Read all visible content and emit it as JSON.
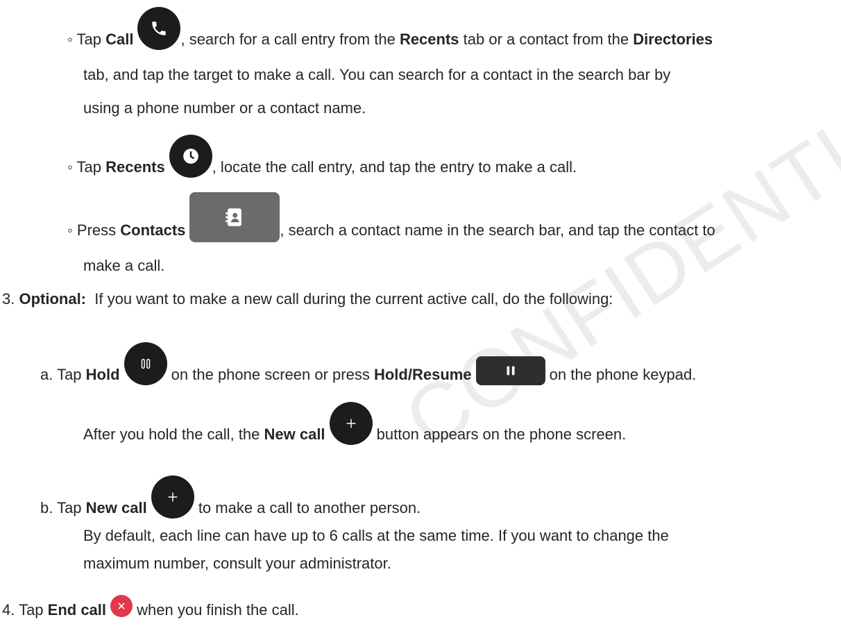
{
  "watermark": "CONFIDENTIAL DRAFT",
  "icons": {
    "call": "phone-icon",
    "recents": "clock-icon",
    "contacts": "contacts-book-icon",
    "hold": "pause-icon",
    "hold_resume": "pause-key-icon",
    "new_call": "plus-icon",
    "end_call": "close-icon"
  },
  "colors": {
    "icon_dark": "#1c1c1c",
    "end_call_red": "#e2384a",
    "key_grey": "#3a3a3a"
  },
  "steps": {
    "call": {
      "bullet": "◦ Tap ",
      "action": "Call",
      "text1a": ", search for a call entry from the ",
      "tab1": "Recents",
      "text1b": " tab or a contact from the ",
      "tab2": "Directories",
      "line2": "tab, and tap the target to make a call. You can search for a contact in the search bar by",
      "line3": "using a phone number or a contact name."
    },
    "recents": {
      "bullet": "◦ Tap ",
      "action": "Recents",
      "text": ", locate the call entry, and tap the entry to make a call."
    },
    "contacts": {
      "bullet": "◦ Press ",
      "action": "Contacts",
      "text": ", search a contact name in the search bar, and tap the contact to",
      "line2": "make a call."
    },
    "step3": {
      "num": "3. ",
      "label": "Optional:",
      "text": "  If you want to make a new call during the current active call, do the following:"
    },
    "step3a": {
      "prefix": "a. Tap ",
      "hold": "Hold",
      "text1": " on the phone screen or press ",
      "hold_resume": "Hold/Resume",
      "text2": " on the phone keypad."
    },
    "after_hold": {
      "text1": "After you hold the call, the ",
      "new_call": "New call",
      "text2": " button appears on the phone screen."
    },
    "step3b": {
      "prefix": "b. Tap ",
      "new_call": "New call",
      "text": " to make a call to another person.",
      "line2": "By default, each line can have up to 6 calls at the same time. If you want to change the",
      "line3": "maximum number, consult your administrator."
    },
    "step4": {
      "prefix": "4. Tap ",
      "end_call": "End call",
      "text": " when you finish the call."
    }
  }
}
